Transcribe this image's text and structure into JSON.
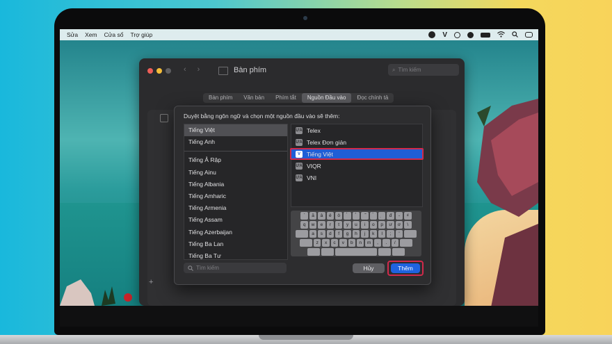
{
  "menubar": {
    "items": [
      "Sửa",
      "Xem",
      "Cửa sổ",
      "Trợ giúp"
    ],
    "status_icons": [
      "line-app-icon",
      "v-input-icon",
      "record-icon",
      "user-icon",
      "battery-icon",
      "wifi-icon",
      "search-icon",
      "control-center-icon"
    ]
  },
  "pref_window": {
    "title": "Bàn phím",
    "search_placeholder": "Tìm kiếm",
    "tabs": [
      "Bàn phím",
      "Văn bản",
      "Phím tắt",
      "Nguồn Đầu vào",
      "Đọc chính tả"
    ],
    "selected_tab": "Nguồn Đầu vào",
    "plus_label": "+"
  },
  "sheet": {
    "prompt": "Duyệt bằng ngôn ngữ và chọn một nguồn đầu vào sẽ thêm:",
    "languages": [
      "Tiếng Việt",
      "Tiếng Anh",
      "Tiếng Ả Rập",
      "Tiếng Ainu",
      "Tiếng Albania",
      "Tiếng Amharic",
      "Tiếng Armenia",
      "Tiếng Assam",
      "Tiếng Azerbaijan",
      "Tiếng Ba Lan",
      "Tiếng Ba Tư"
    ],
    "selected_language": "Tiếng Việt",
    "input_sources": [
      {
        "label": "Telex",
        "icon": "ƯA"
      },
      {
        "label": "Telex Đơn giản",
        "icon": "ƯA"
      },
      {
        "label": "Tiếng Việt",
        "icon": "V"
      },
      {
        "label": "VIQR",
        "icon": "ƯA"
      },
      {
        "label": "VNI",
        "icon": "ƯA"
      }
    ],
    "selected_source": "Tiếng Việt",
    "keyboard_rows": [
      [
        "`",
        "ă",
        "â",
        "ê",
        "ô",
        "̀",
        "̉",
        "̃",
        "́",
        "̣",
        "đ",
        "-",
        "₫"
      ],
      [
        "q",
        "w",
        "e",
        "r",
        "t",
        "y",
        "u",
        "i",
        "o",
        "p",
        "ư",
        "ơ",
        "\\"
      ],
      [
        "a",
        "s",
        "d",
        "f",
        "g",
        "h",
        "j",
        "k",
        "l",
        ";",
        "'"
      ],
      [
        "z",
        "x",
        "c",
        "v",
        "b",
        "n",
        "m",
        ",",
        ".",
        "/"
      ]
    ],
    "search_placeholder": "Tìm kiếm",
    "cancel_label": "Hủy",
    "add_label": "Thêm"
  },
  "colors": {
    "accent": "#1f63e0",
    "highlight_border": "#d22a4b"
  }
}
